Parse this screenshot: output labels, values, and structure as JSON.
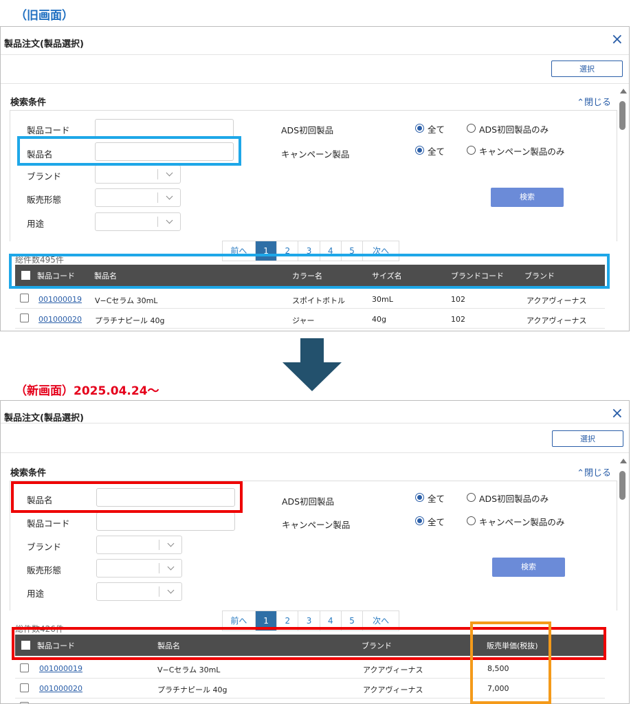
{
  "old_label": "（旧画面）",
  "new_label": "（新画面）2025.04.24～",
  "dialog": {
    "title": "製品注文(製品選択)",
    "close_icon": "×",
    "select_label": "選択",
    "search_title": "検索条件",
    "collapse_label": "閉じる",
    "search_button": "検索"
  },
  "form": {
    "product_code": "製品コード",
    "product_name": "製品名",
    "brand": "ブランド",
    "sales_form": "販売形態",
    "usage": "用途",
    "ads_first": "ADS初回製品",
    "campaign": "キャンペーン製品",
    "all": "全て",
    "ads_only": "ADS初回製品のみ",
    "campaign_only": "キャンペーン製品のみ"
  },
  "pagination": {
    "prev": "前へ",
    "pages": [
      "1",
      "2",
      "3",
      "4",
      "5"
    ],
    "next": "次へ"
  },
  "old_table": {
    "total": "総件数495件",
    "headers": [
      "製品コード",
      "製品名",
      "カラー名",
      "サイズ名",
      "ブランドコード",
      "ブランド"
    ],
    "rows": [
      [
        "001000019",
        "V−Cセラム 30mL",
        "スポイトボトル",
        "30mL",
        "102",
        "アクアヴィーナス"
      ],
      [
        "001000020",
        "プラチナピール 40g",
        "ジャー",
        "40g",
        "102",
        "アクアヴィーナス"
      ]
    ]
  },
  "new_table": {
    "total": "総件数426件",
    "headers": [
      "製品コード",
      "製品名",
      "ブランド",
      "販売単価(税抜)"
    ],
    "rows": [
      [
        "001000019",
        "V−Cセラム 30mL",
        "アクアヴィーナス",
        "8,500"
      ],
      [
        "001000020",
        "プラチナピール 40g",
        "アクアヴィーナス",
        "7,000"
      ]
    ]
  },
  "colors": {
    "old_label": "#1f6fc1",
    "new_label": "#e5001b",
    "highlight_blue": "#1ea7e8",
    "highlight_red": "#ee0000",
    "highlight_orange": "#f49a1a",
    "arrow": "#23516d"
  }
}
